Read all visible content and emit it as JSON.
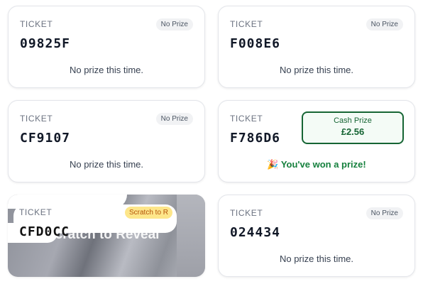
{
  "ticket_label": "TICKET",
  "no_prize_message": "No prize this time.",
  "no_prize_badge": "No Prize",
  "colors": {
    "win_green": "#15803d",
    "badge_bg": "#f1f2f4",
    "scratch_badge_bg": "#fde68a"
  },
  "tickets": [
    {
      "code": "09825F",
      "badge": "No Prize",
      "message": "No prize this time."
    },
    {
      "code": "F008E6",
      "badge": "No Prize",
      "message": "No prize this time."
    },
    {
      "code": "CF9107",
      "badge": "No Prize",
      "message": "No prize this time."
    },
    {
      "code": "F786D6",
      "cash_prize_label": "Cash Prize",
      "cash_prize_amount": "£2.56",
      "message": "🎉 You've won a prize!"
    },
    {
      "code": "CFD0CC",
      "badge": "Scratch to R",
      "overlay_text": "Scratch to Reveal"
    },
    {
      "code": "024434",
      "badge": "No Prize",
      "message": "No prize this time."
    }
  ]
}
